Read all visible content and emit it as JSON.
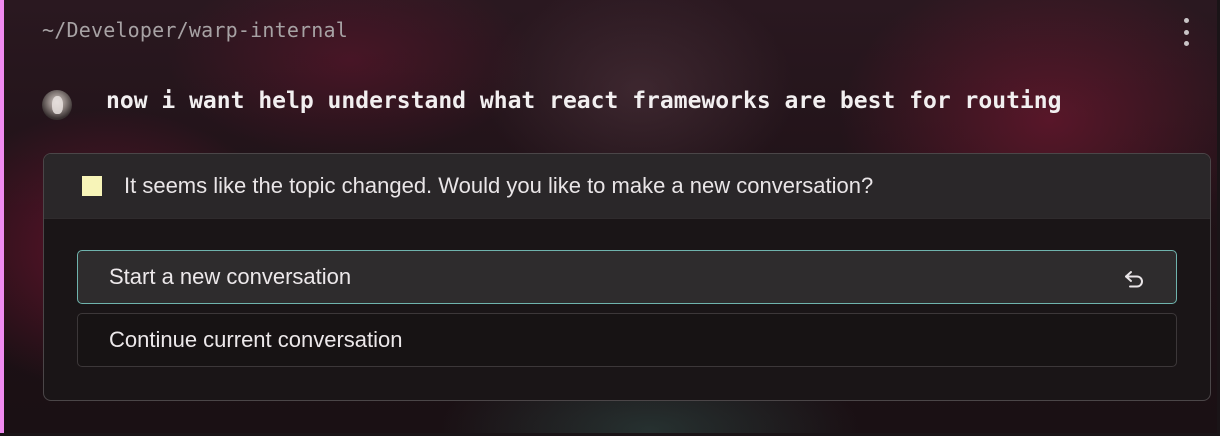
{
  "header": {
    "path": "~/Developer/warp-internal",
    "menu_icon": "more-vertical-icon"
  },
  "prompt": {
    "avatar_icon": "user-avatar",
    "text": "now i want help understand what react frameworks are best for routing"
  },
  "topic_change": {
    "indicator_color": "#f7f4b8",
    "message": "It seems like the topic changed. Would you like to make a new conversation?",
    "options": [
      {
        "label": "Start a new conversation",
        "selected": true,
        "shortcut_icon": "enter-return-icon"
      },
      {
        "label": "Continue current conversation",
        "selected": false
      }
    ]
  },
  "colors": {
    "accent_left_bar": "#f08af0",
    "selected_option_border": "#6fb3ad"
  }
}
